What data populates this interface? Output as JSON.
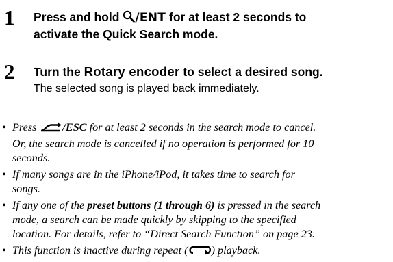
{
  "step1": {
    "number": "1",
    "pre": "Press and hold ",
    "ent": "/ENT",
    "post": " for at least 2 seconds to",
    "line2": "activate the Quick Search mode.",
    "icon": "search-icon"
  },
  "step2": {
    "number": "2",
    "pre": "Turn the ",
    "rotary": "Rotary encoder",
    "post": " to select a desired song.",
    "sub": "The selected song is played back immediately."
  },
  "notes": {
    "bullet": "•",
    "n1": {
      "pre": "Press ",
      "esc": "/ESC",
      "l1": " for at least 2 seconds in the search mode to cancel.",
      "l2": "Or, the search mode is cancelled if no operation is performed for 10",
      "l3": "seconds.",
      "icon": "back-arrow-icon"
    },
    "n2": {
      "l1": "If many songs are in the iPhone/iPod, it takes time to search for",
      "l2": "songs."
    },
    "n3": {
      "pre": "If any one of the ",
      "bold": "preset buttons (1 through 6)",
      "post": " is pressed in the search",
      "l2": "mode, a search can be made quickly by skipping to the specified",
      "l3": "location. For details, refer to “Direct Search Function” on page 23."
    },
    "n4": {
      "pre": "This function is inactive during repeat (",
      "post": ") playback.",
      "icon": "repeat-icon"
    }
  }
}
